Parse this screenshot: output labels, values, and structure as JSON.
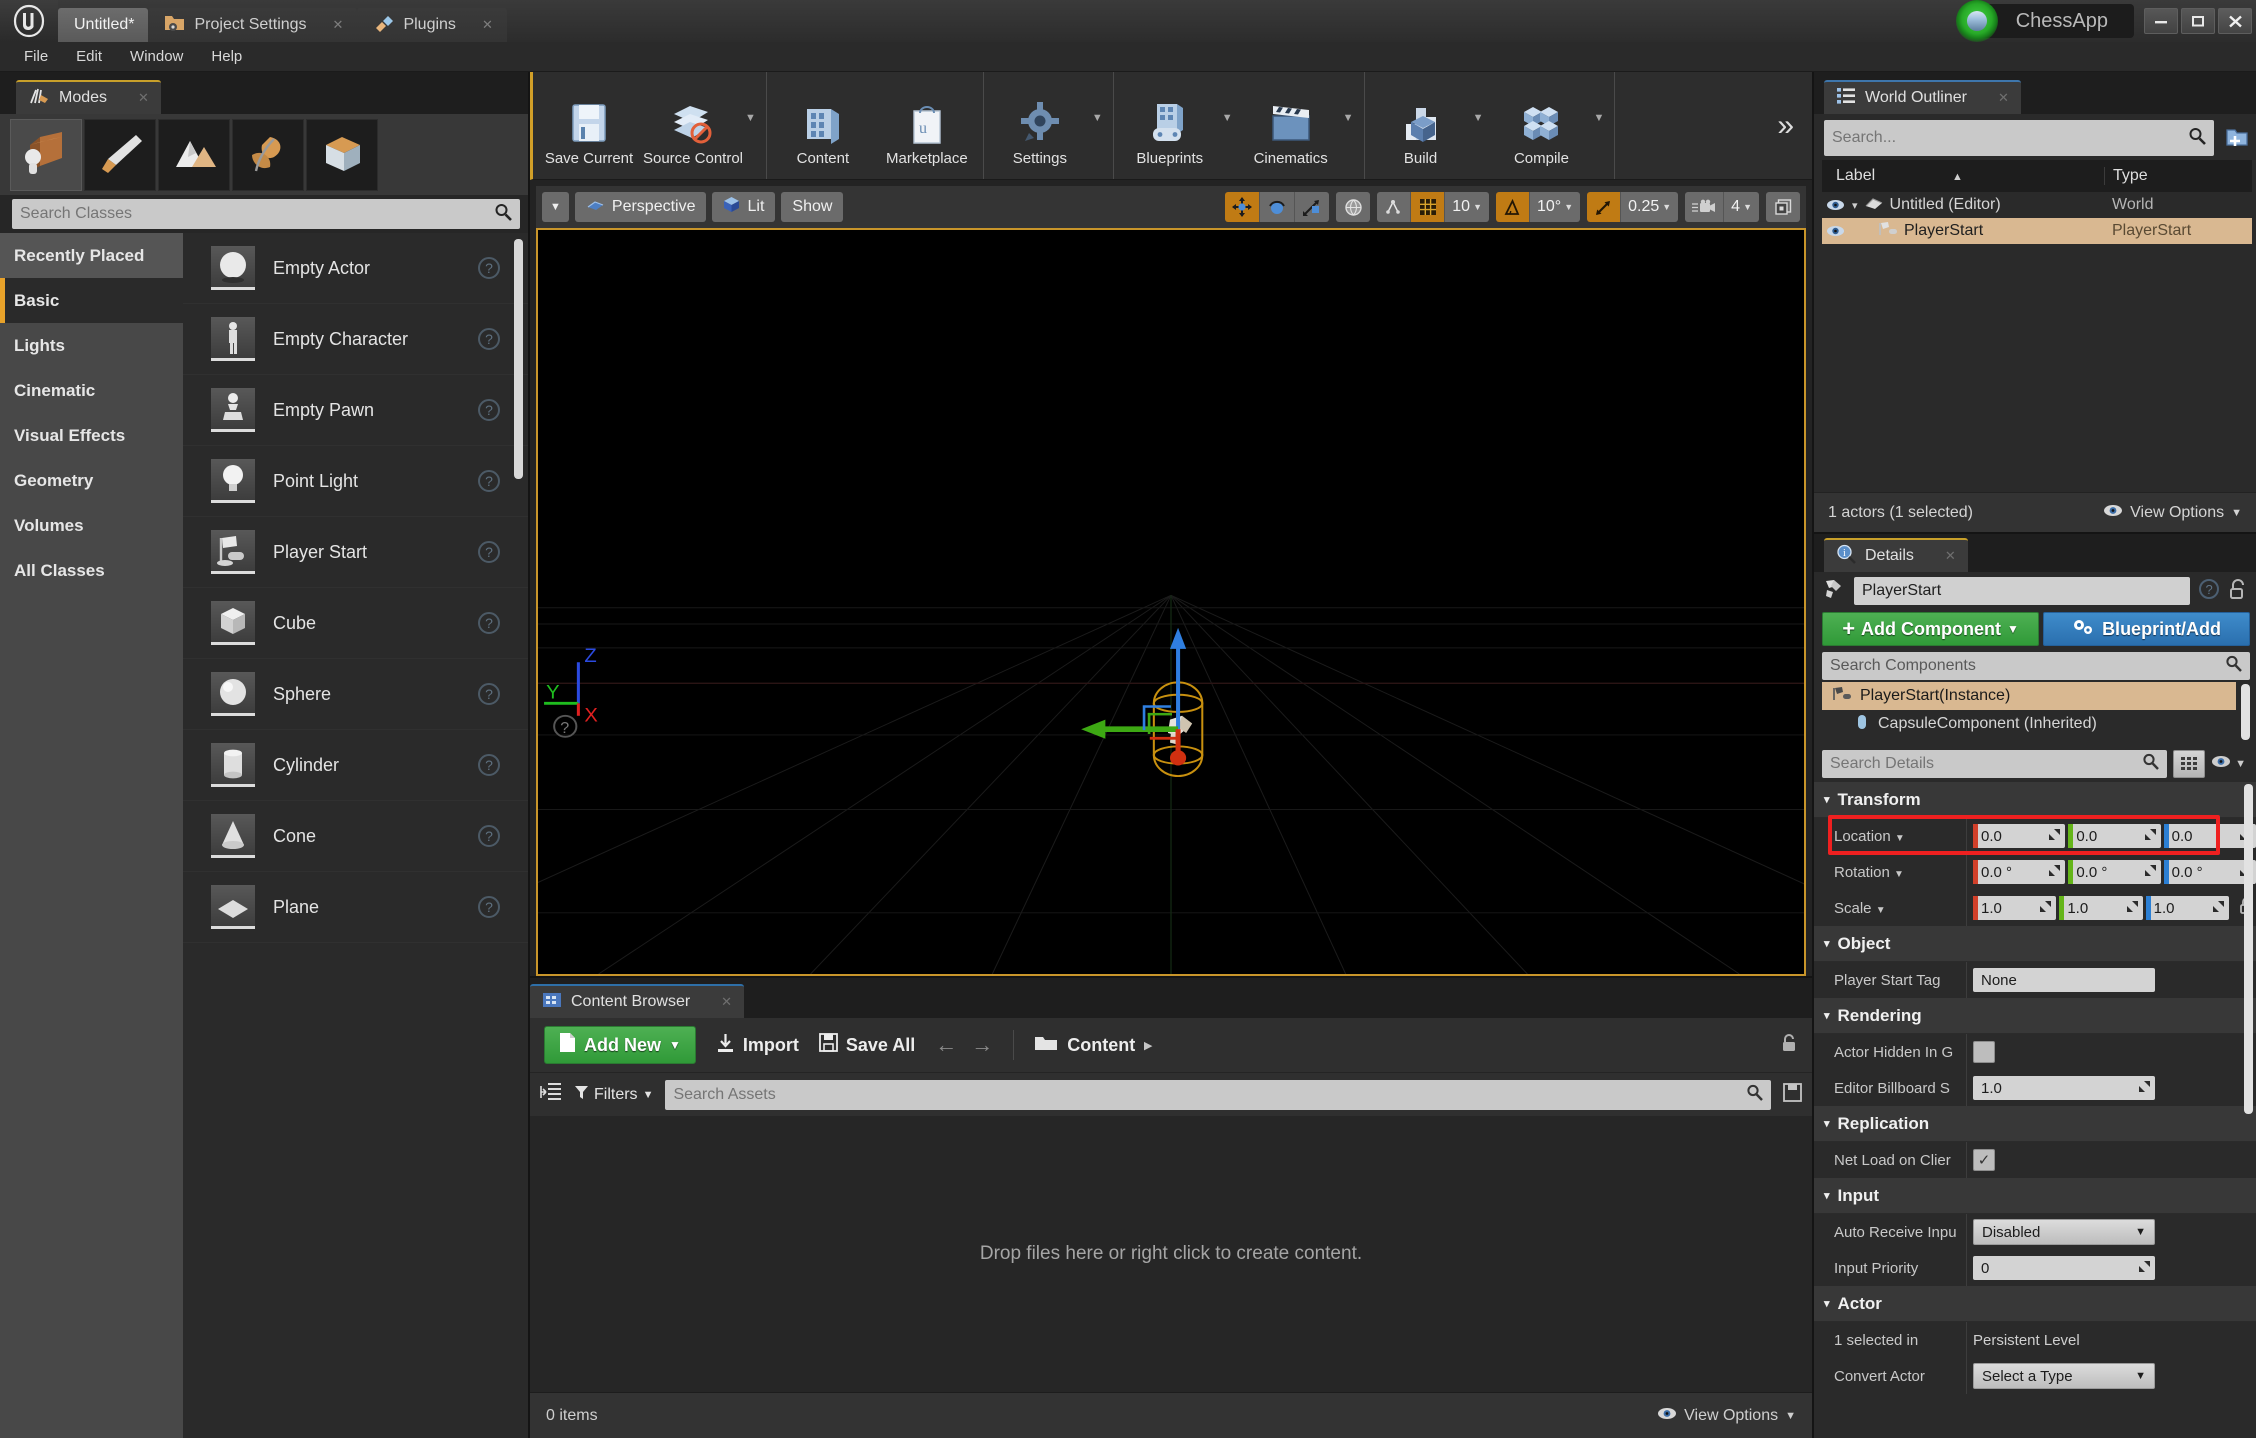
{
  "titlebar": {
    "logo": "ue-logo",
    "tabs": [
      {
        "label": "Untitled*",
        "active": true,
        "icon": ""
      },
      {
        "label": "Project Settings",
        "active": false,
        "icon": "folder-gear-icon"
      },
      {
        "label": "Plugins",
        "active": false,
        "icon": "plug-icon"
      }
    ],
    "project_name": "ChessApp",
    "window_buttons": {
      "minimize": "–",
      "maximize": "❐",
      "close": "✕"
    }
  },
  "menubar": {
    "items": [
      "File",
      "Edit",
      "Window",
      "Help"
    ]
  },
  "toolbar": {
    "groups": [
      {
        "buttons": [
          {
            "label": "Save Current",
            "icon": "floppy-disk-icon",
            "caret": false
          },
          {
            "label": "Source Control",
            "icon": "source-control-icon",
            "caret": true
          }
        ]
      },
      {
        "buttons": [
          {
            "label": "Content",
            "icon": "content-folder-icon",
            "caret": false
          },
          {
            "label": "Marketplace",
            "icon": "marketplace-bag-icon",
            "caret": false
          }
        ]
      },
      {
        "buttons": [
          {
            "label": "Settings",
            "icon": "gear-icon",
            "caret": true
          }
        ]
      },
      {
        "buttons": [
          {
            "label": "Blueprints",
            "icon": "blueprint-icon",
            "caret": true
          },
          {
            "label": "Cinematics",
            "icon": "clapperboard-icon",
            "caret": true
          }
        ]
      },
      {
        "buttons": [
          {
            "label": "Build",
            "icon": "build-blocks-icon",
            "caret": true
          },
          {
            "label": "Compile",
            "icon": "compile-cubes-icon",
            "caret": true
          }
        ]
      }
    ],
    "overflow": "»"
  },
  "modes": {
    "tab_label": "Modes",
    "tab_icon": "modes-icon",
    "mode_buttons": [
      {
        "name": "place-mode",
        "icon": "place-actor-icon",
        "selected": true
      },
      {
        "name": "paint-mode",
        "icon": "paint-brush-icon",
        "selected": false
      },
      {
        "name": "landscape-mode",
        "icon": "landscape-icon",
        "selected": false
      },
      {
        "name": "foliage-mode",
        "icon": "foliage-leaf-icon",
        "selected": false
      },
      {
        "name": "geometry-mode",
        "icon": "geometry-box-icon",
        "selected": false
      }
    ],
    "search_placeholder": "Search Classes",
    "search_value": "",
    "categories": [
      {
        "label": "Recently Placed",
        "state": "recent"
      },
      {
        "label": "Basic",
        "state": "selected"
      },
      {
        "label": "Lights",
        "state": ""
      },
      {
        "label": "Cinematic",
        "state": ""
      },
      {
        "label": "Visual Effects",
        "state": ""
      },
      {
        "label": "Geometry",
        "state": ""
      },
      {
        "label": "Volumes",
        "state": ""
      },
      {
        "label": "All Classes",
        "state": ""
      }
    ],
    "items": [
      {
        "label": "Empty Actor",
        "icon": "sphere-thumb-icon"
      },
      {
        "label": "Empty Character",
        "icon": "character-thumb-icon"
      },
      {
        "label": "Empty Pawn",
        "icon": "pawn-thumb-icon"
      },
      {
        "label": "Point Light",
        "icon": "bulb-thumb-icon"
      },
      {
        "label": "Player Start",
        "icon": "playerstart-thumb-icon"
      },
      {
        "label": "Cube",
        "icon": "cube-thumb-icon"
      },
      {
        "label": "Sphere",
        "icon": "sphere2-thumb-icon"
      },
      {
        "label": "Cylinder",
        "icon": "cylinder-thumb-icon"
      },
      {
        "label": "Cone",
        "icon": "cone-thumb-icon"
      },
      {
        "label": "Plane",
        "icon": "plane-thumb-icon"
      }
    ]
  },
  "viewport": {
    "menu_caret": "▼",
    "perspective_label": "Perspective",
    "lit_label": "Lit",
    "show_label": "Show",
    "transform_tools": [
      {
        "name": "translate-tool",
        "icon": "move-arrows-icon",
        "active": true
      },
      {
        "name": "rotate-tool",
        "icon": "rotate-icon",
        "active": false
      },
      {
        "name": "scale-tool",
        "icon": "scale-icon",
        "active": false
      }
    ],
    "coord_space": {
      "name": "world-space-toggle",
      "icon": "globe-icon",
      "active": false
    },
    "surface_snap": {
      "name": "surface-snap-toggle",
      "icon": "surface-snap-icon",
      "active": false
    },
    "grid_snap": {
      "name": "grid-snap-toggle",
      "icon": "grid-icon",
      "active": true,
      "value": "10"
    },
    "angle_snap": {
      "name": "angle-snap-toggle",
      "icon": "angle-icon",
      "active": true,
      "value": "10°"
    },
    "scale_snap": {
      "name": "scale-snap-toggle",
      "icon": "scale-snap-icon",
      "active": true,
      "value": "0.25"
    },
    "camera_speed": {
      "name": "camera-speed",
      "icon": "camera-icon",
      "value": "4"
    },
    "maximize": {
      "name": "maximize-viewport",
      "icon": "maximize-icon"
    },
    "axis_gizmo": {
      "x": "X",
      "y": "Y",
      "z": "Z",
      "help": "?"
    }
  },
  "content_browser": {
    "tab_label": "Content Browser",
    "tab_icon": "content-browser-icon",
    "add_new": "Add New",
    "import": "Import",
    "save_all": "Save All",
    "back_arrow": "←",
    "forward_arrow": "→",
    "breadcrumb": "Content",
    "breadcrumb_caret": "▸",
    "lock_icon": "lock-icon",
    "filters_label": "Filters",
    "search_placeholder": "Search Assets",
    "search_value": "",
    "empty_text": "Drop files here or right click to create content.",
    "status_items": "0 items",
    "view_options": "View Options"
  },
  "outliner": {
    "tab_label": "World Outliner",
    "tab_icon": "outliner-icon",
    "search_placeholder": "Search...",
    "search_value": "",
    "add_icon": "add-folder-icon",
    "columns": {
      "label": "Label",
      "type": "Type"
    },
    "rows": [
      {
        "label": "Untitled (Editor)",
        "type": "World",
        "selected": false,
        "indent": 0,
        "icon": "world-icon",
        "expander": "▾"
      },
      {
        "label": "PlayerStart",
        "type": "PlayerStart",
        "selected": true,
        "indent": 1,
        "icon": "playerstart-icon",
        "expander": ""
      }
    ],
    "status": "1 actors (1 selected)",
    "view_options": "View Options"
  },
  "details": {
    "tab_label": "Details",
    "tab_icon": "details-info-icon",
    "actor_name": "PlayerStart",
    "actor_icon": "playerstart-icon",
    "help_icon": "help-circle-icon",
    "lock_icon": "padlock-icon",
    "add_component": "Add Component",
    "blueprint_button": "Blueprint/Add",
    "search_components_placeholder": "Search Components",
    "components": [
      {
        "label": "PlayerStart(Instance)",
        "selected": true,
        "indent": 0,
        "icon": "playerstart-icon"
      },
      {
        "label": "CapsuleComponent (Inherited)",
        "selected": false,
        "indent": 1,
        "icon": "capsule-icon"
      }
    ],
    "search_details_placeholder": "Search Details",
    "sections": [
      {
        "name": "Transform",
        "rows": [
          {
            "label": "Location",
            "type": "vector3",
            "dropdown": true,
            "values": [
              "0.0",
              "0.0",
              "0.0"
            ],
            "highlighted": true
          },
          {
            "label": "Rotation",
            "type": "vector3",
            "dropdown": true,
            "values": [
              "0.0 °",
              "0.0 °",
              "0.0 °"
            ],
            "highlighted": false
          },
          {
            "label": "Scale",
            "type": "vector3",
            "dropdown": true,
            "values": [
              "1.0",
              "1.0",
              "1.0"
            ],
            "highlighted": false,
            "lock": true
          }
        ]
      },
      {
        "name": "Object",
        "rows": [
          {
            "label": "Player Start Tag",
            "type": "text",
            "value": "None"
          }
        ]
      },
      {
        "name": "Rendering",
        "rows": [
          {
            "label": "Actor Hidden In G",
            "type": "checkbox",
            "checked": false
          },
          {
            "label": "Editor Billboard S",
            "type": "number",
            "value": "1.0"
          }
        ]
      },
      {
        "name": "Replication",
        "rows": [
          {
            "label": "Net Load on Clier",
            "type": "checkbox",
            "checked": true
          }
        ]
      },
      {
        "name": "Input",
        "rows": [
          {
            "label": "Auto Receive Inpu",
            "type": "select",
            "value": "Disabled"
          },
          {
            "label": "Input Priority",
            "type": "number",
            "value": "0"
          }
        ]
      },
      {
        "name": "Actor",
        "rows": [
          {
            "label": "1 selected in",
            "type": "plain",
            "value": "Persistent Level"
          },
          {
            "label": "Convert Actor",
            "type": "select",
            "value": "Select a Type"
          }
        ]
      }
    ]
  },
  "colors": {
    "accent_orange": "#c8952a",
    "highlight_red": "#ef2020",
    "selection_tan": "#d9b891",
    "green_button": "#309a38",
    "blue_button": "#2a6fae",
    "axis_x": "#d1402a",
    "axis_y": "#64b519",
    "axis_z": "#2b7fd4"
  }
}
